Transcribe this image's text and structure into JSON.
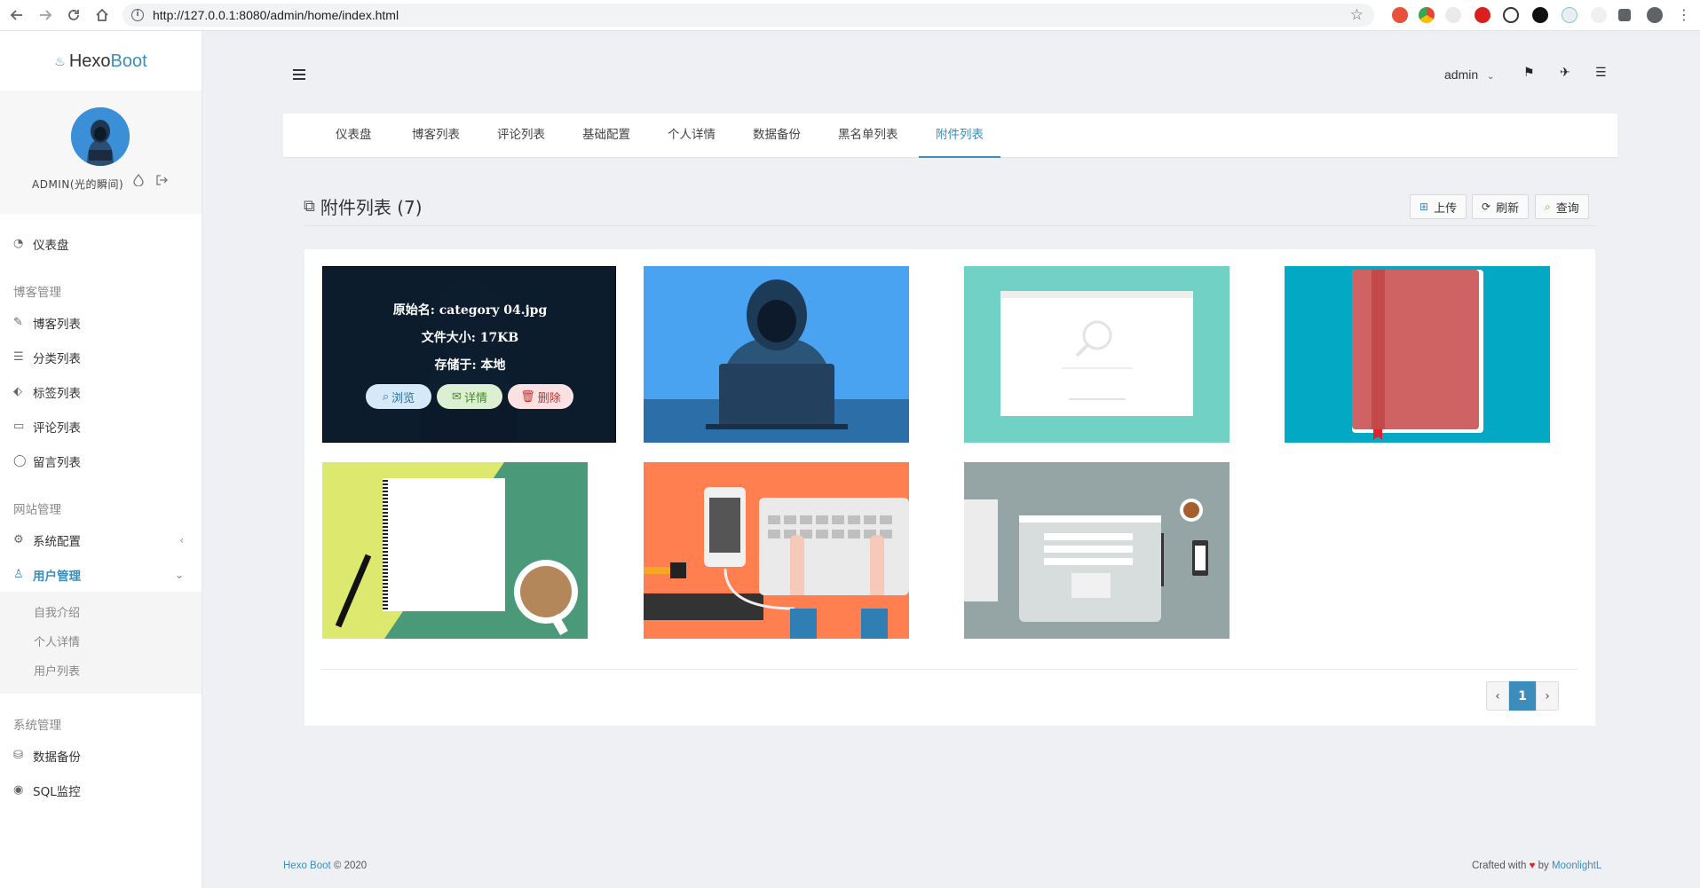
{
  "browser": {
    "url": "http://127.0.0.1:8080/admin/home/index.html",
    "info_glyph": "i",
    "star_glyph": "☆"
  },
  "sidebar": {
    "brand_prefix": "Hexo",
    "brand_suffix": "Boot",
    "profile_name": "ADMIN(光的瞬间)",
    "items": {
      "dashboard": "仪表盘",
      "blog_section": "博客管理",
      "blog_list": "博客列表",
      "category_list": "分类列表",
      "tag_list": "标签列表",
      "comment_list": "评论列表",
      "message_list": "留言列表",
      "site_section": "网站管理",
      "system_config": "系统配置",
      "user_management": "用户管理",
      "about_me": "自我介绍",
      "personal_detail": "个人详情",
      "user_list": "用户列表",
      "system_section": "系统管理",
      "data_backup": "数据备份",
      "sql_monitor": "SQL监控"
    }
  },
  "header": {
    "username": "admin"
  },
  "tabs": [
    "仪表盘",
    "博客列表",
    "评论列表",
    "基础配置",
    "个人详情",
    "数据备份",
    "黑名单列表",
    "附件列表"
  ],
  "page": {
    "title": "附件列表 (7)",
    "upload_label": "上传",
    "refresh_label": "刷新",
    "search_label": "查询"
  },
  "overlay": {
    "original_name": "原始名: category 04.jpg",
    "file_size": "文件大小: 17KB",
    "stored_at": "存储于: 本地",
    "browse_label": "浏览",
    "detail_label": "详情",
    "delete_label": "删除"
  },
  "pagination": {
    "prev": "‹",
    "current": "1",
    "next": "›"
  },
  "footer": {
    "brand": "Hexo Boot",
    "copyright": "© 2020",
    "crafted": "Crafted with",
    "by": "by",
    "author": "MoonlightL"
  },
  "colors": {
    "accent": "#3c8dbc",
    "delete": "#d9534f",
    "detail": "#5a9e3a"
  }
}
